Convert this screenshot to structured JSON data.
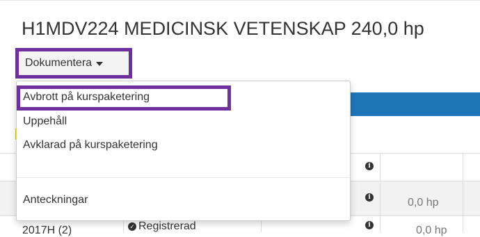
{
  "page": {
    "title": "H1MDV224 MEDICINSK VETENSKAP 240,0 hp"
  },
  "toolbar": {
    "document_button_label": "Dokumentera"
  },
  "dropdown": {
    "items": [
      {
        "label": "Avbrott på kurspaketering",
        "highlighted": true
      },
      {
        "label": "Uppehåll"
      },
      {
        "label": "Avklarad på kurspaketering"
      },
      {
        "label": "Anteckningar"
      }
    ]
  },
  "table": {
    "rows": [
      {
        "hp": ""
      },
      {
        "hp": "0,0 hp"
      },
      {
        "term": "2017H (2)",
        "status": "Registrerad",
        "hp": "0,0 hp"
      }
    ]
  },
  "colors": {
    "highlight_border": "#6f2f9f",
    "blue_bar": "#1e75b8",
    "yellow_accent": "#f3c200"
  },
  "icons": [
    "caret-down-icon",
    "info-icon",
    "check-circle-icon"
  ]
}
